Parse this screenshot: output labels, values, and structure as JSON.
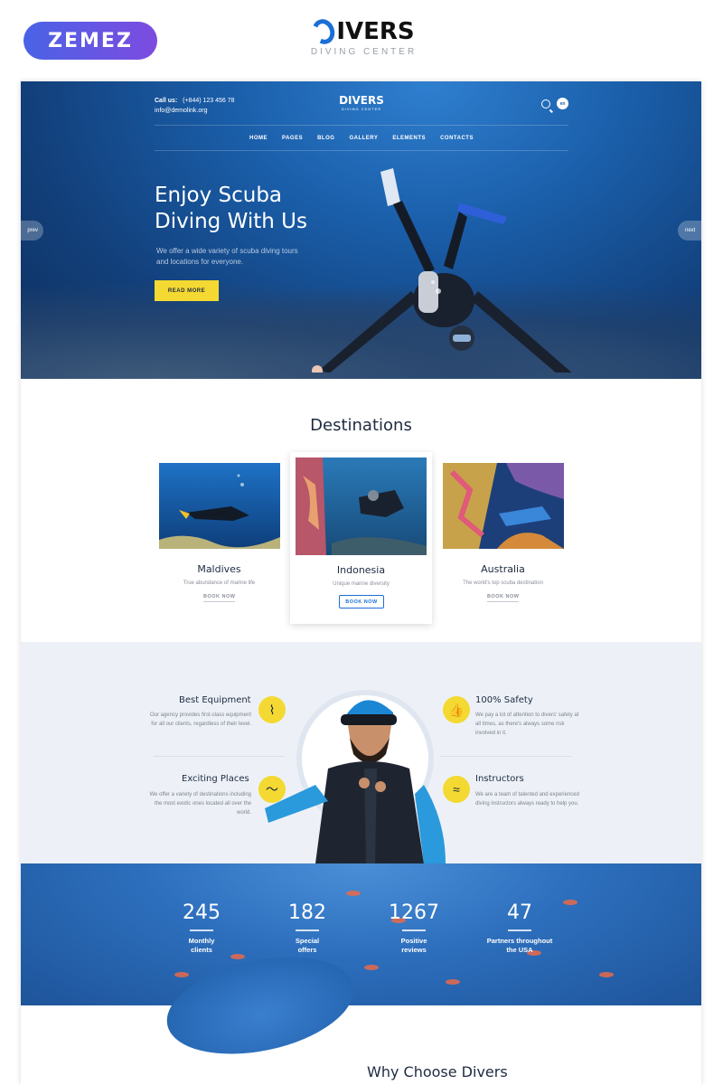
{
  "top": {
    "zemez_label": "ZEMEZ",
    "brand_word": "IVERS",
    "brand_sub": "DIVING CENTER"
  },
  "hero": {
    "call_label": "Call us:",
    "phone": "(+844) 123 456 78",
    "email": "info@demolink.org",
    "logo_word": "DIVERS",
    "logo_sub": "DIVING CENTER",
    "lang": "en",
    "nav": [
      "HOME",
      "PAGES",
      "BLOG",
      "GALLERY",
      "ELEMENTS",
      "CONTACTS"
    ],
    "title": "Enjoy Scuba Diving With Us",
    "text": "We offer a wide variety of scuba diving tours and locations for everyone.",
    "button": "READ MORE",
    "prev": "prev",
    "next": "next"
  },
  "destinations": {
    "title": "Destinations",
    "cards": [
      {
        "name": "Maldives",
        "desc": "True abundance of marine life",
        "book": "BOOK NOW"
      },
      {
        "name": "Indonesia",
        "desc": "Unique marine diversity",
        "book": "BOOK NOW"
      },
      {
        "name": "Australia",
        "desc": "The world's top scuba destination",
        "book": "BOOK NOW"
      }
    ]
  },
  "features": {
    "items": [
      {
        "title": "Best Equipment",
        "text": "Our agency provides first-class equipment for all our clients, regardless of their level.",
        "icon": "snorkel-icon"
      },
      {
        "title": "100% Safety",
        "text": "We pay a lot of attention to divers' safety at all times, as there's always some risk involved in it.",
        "icon": "thumbs-up-icon"
      },
      {
        "title": "Exciting Places",
        "text": "We offer a variety of destinations including the most exotic ones located all over the world.",
        "icon": "dolphin-icon"
      },
      {
        "title": "Instructors",
        "text": "We are a team of talented and experienced diving instructors always ready to help you.",
        "icon": "swimmer-icon"
      }
    ]
  },
  "counters": [
    {
      "num": "245",
      "label": "Monthly clients"
    },
    {
      "num": "182",
      "label": "Special offers"
    },
    {
      "num": "1267",
      "label": "Positive reviews"
    },
    {
      "num": "47",
      "label": "Partners throughout the USA"
    }
  ],
  "why": {
    "title": "Why Choose Divers"
  },
  "colors": {
    "accent_yellow": "#f4d932",
    "brand_blue": "#1b6fd6",
    "dark_text": "#1d2a40"
  }
}
